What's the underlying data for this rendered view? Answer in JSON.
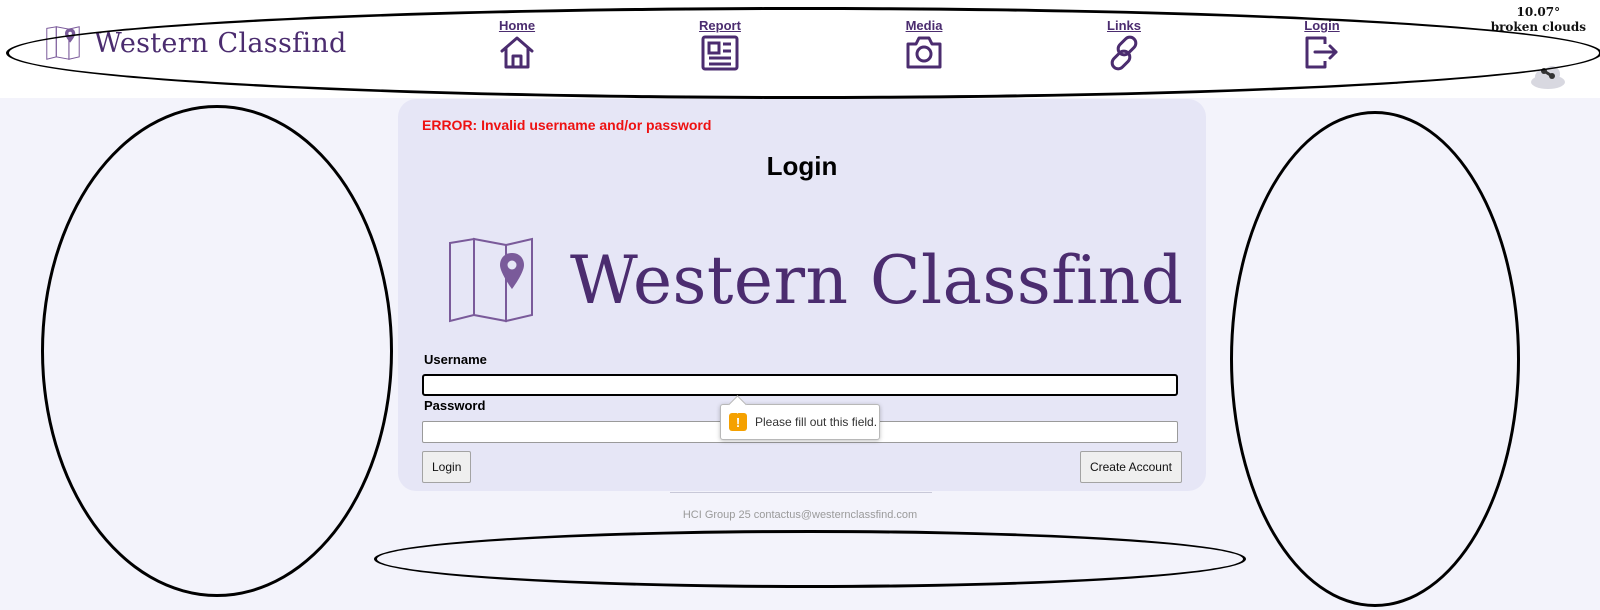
{
  "header": {
    "brand": "Western Classfind",
    "nav": [
      {
        "label": "Home",
        "icon": "home-icon"
      },
      {
        "label": "Report",
        "icon": "newspaper-icon"
      },
      {
        "label": "Media",
        "icon": "camera-icon"
      },
      {
        "label": "Links",
        "icon": "link-icon"
      },
      {
        "label": "Login",
        "icon": "logout-icon"
      }
    ],
    "weather": {
      "temp": "10.07°",
      "desc": "broken clouds",
      "icon": "cloud-icon"
    }
  },
  "login": {
    "error": "ERROR: Invalid username and/or password",
    "title": "Login",
    "logo_text": "Western Classfind",
    "username_label": "Username",
    "username_value": "",
    "password_label": "Password",
    "password_value": "",
    "login_button": "Login",
    "create_account_button": "Create Account",
    "validation_tooltip": "Please fill out this field."
  },
  "footer": {
    "text": "HCI Group 25 contactus@westernclassfind.com"
  },
  "colors": {
    "brand": "#4b2c6f",
    "error": "#ee1111",
    "card": "#e6e6f6",
    "warning": "#f5a100"
  }
}
